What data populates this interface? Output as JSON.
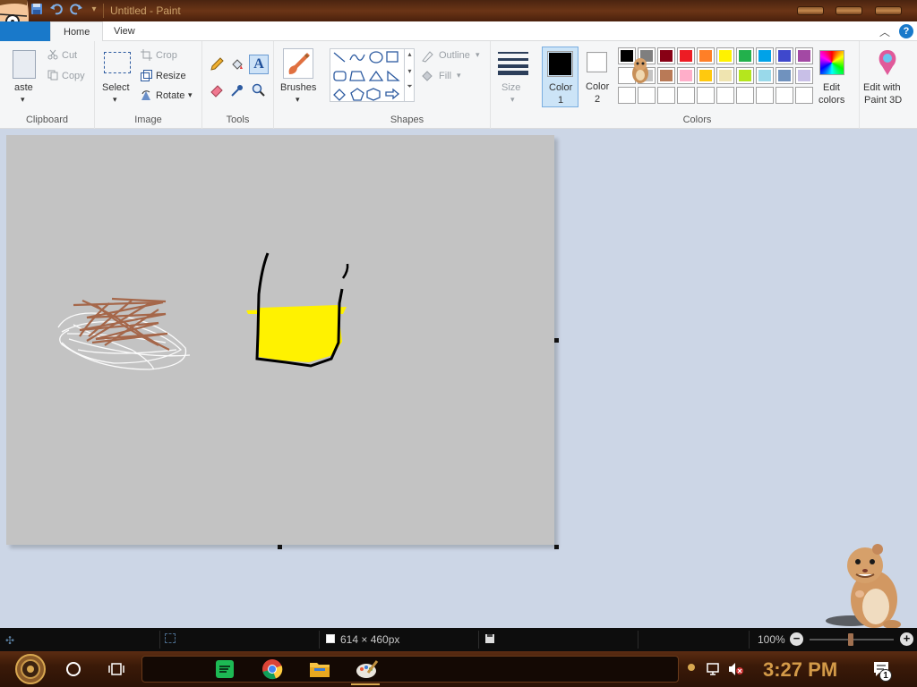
{
  "window": {
    "title": "Untitled - Paint"
  },
  "tabs": {
    "home": "Home",
    "view": "View",
    "help": "?"
  },
  "clipboard": {
    "paste": "aste",
    "cut": "Cut",
    "copy": "Copy",
    "group": "Clipboard"
  },
  "image": {
    "select": "Select",
    "crop": "Crop",
    "resize": "Resize",
    "rotate": "Rotate",
    "group": "Image"
  },
  "tools": {
    "text": "A",
    "group": "Tools"
  },
  "brushes": {
    "label": "Brushes"
  },
  "shapes": {
    "outline": "Outline",
    "fill": "Fill",
    "group": "Shapes"
  },
  "size": {
    "label": "Size"
  },
  "colors": {
    "color1_label": "Color",
    "color1_num": "1",
    "color2_label": "Color",
    "color2_num": "2",
    "edit_line1": "Edit",
    "edit_line2": "colors",
    "paint3d_line1": "Edit with",
    "paint3d_line2": "Paint 3D",
    "group": "Colors",
    "color1_value": "#000000",
    "color2_value": "#ffffff",
    "palette_row1": [
      "#000000",
      "#7f7f7f",
      "#880015",
      "#ed1c24",
      "#ff7f27",
      "#fff200",
      "#22b14c",
      "#00a2e8",
      "#3f48cc",
      "#a349a4"
    ],
    "palette_row2": [
      "#ffffff",
      "#c3c3c3",
      "#b97a57",
      "#ffaec9",
      "#ffc90e",
      "#efe4b0",
      "#b5e61d",
      "#99d9ea",
      "#7092be",
      "#c8bfe7"
    ]
  },
  "status": {
    "dimensions": "614 × 460px",
    "zoom": "100%"
  },
  "taskbar": {
    "time": "3:27 PM",
    "notification_count": "1"
  }
}
